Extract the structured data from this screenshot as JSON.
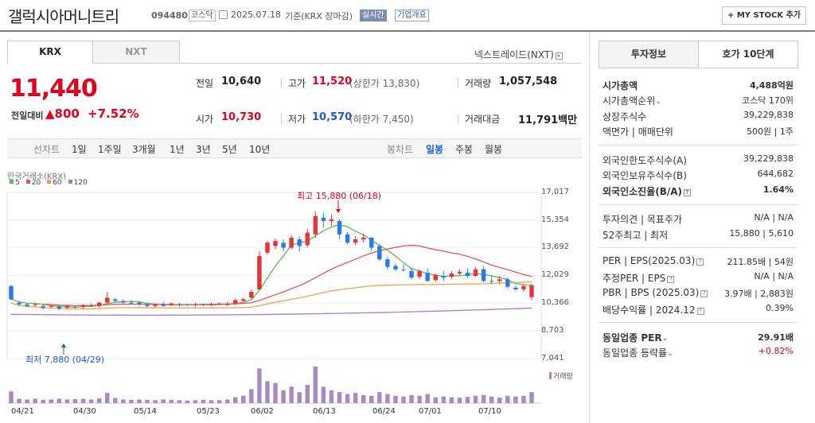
{
  "header": {
    "name": "갤럭시아머니트리",
    "code": "094480",
    "market": "코스닥",
    "date": "2025.07.18",
    "basis": "기준(KRX 장마감)",
    "realtime": "실시간",
    "overview": "기업개요",
    "mystock": "+ MY STOCK 추가"
  },
  "tabs": {
    "krx": "KRX",
    "nxt": "NXT",
    "nxt_link": "넥스트레이드(NXT)"
  },
  "price": {
    "current": "11,440",
    "change_label": "전일대비",
    "change": "▲800",
    "change_pct": "+7.52%"
  },
  "stats": {
    "prev_label": "전일",
    "prev": "10,640",
    "high_label": "고가",
    "high": "11,520",
    "upper_limit": "(상한가 13,830)",
    "volume_label": "거래량",
    "volume": "1,057,548",
    "open_label": "시가",
    "open": "10,730",
    "low_label": "저가",
    "low": "10,570",
    "lower_limit": "(하한가 7,450)",
    "amount_label": "거래대금",
    "amount": "11,791",
    "amount_unit": "백만"
  },
  "period": {
    "line_label": "선차트",
    "p1": "1일",
    "p2": "1주일",
    "p3": "3개월",
    "p4": "1년",
    "p5": "3년",
    "p6": "5년",
    "p7": "10년",
    "candle_label": "봉차트",
    "daily": "일봉",
    "weekly": "주봉",
    "monthly": "월봉"
  },
  "chart": {
    "source": "한국거래소(KRX)",
    "ma": [
      "5",
      "20",
      "60",
      "120"
    ],
    "ma_colors": [
      "#5cb85c",
      "#e8525a",
      "#f0a050",
      "#a87cc8"
    ],
    "high_note": "최고 15,880 (06/18)",
    "low_note": "최저 7,880 (04/29)",
    "yticks": [
      "17,017",
      "15,354",
      "13,692",
      "12,029",
      "10,366",
      "8,703",
      "7,041"
    ],
    "xticks": [
      "04/21",
      "04/30",
      "05/14",
      "05/23",
      "06/02",
      "06/13",
      "06/24",
      "07/01",
      "07/10"
    ],
    "volume_label": "거래량"
  },
  "chart_data": {
    "type": "candlestick",
    "ylim": [
      7041,
      17017
    ],
    "candles": [
      [
        11400,
        10600,
        11450,
        10550
      ],
      [
        10400,
        10300,
        10500,
        10200
      ],
      [
        10300,
        10200,
        10350,
        10150
      ],
      [
        10250,
        10300,
        10400,
        10150
      ],
      [
        10200,
        10100,
        10300,
        10000
      ],
      [
        10150,
        10200,
        10250,
        10100
      ],
      [
        10150,
        10050,
        10250,
        9950
      ],
      [
        10100,
        10200,
        10250,
        10000
      ],
      [
        10150,
        10100,
        10250,
        10050
      ],
      [
        10150,
        10250,
        10300,
        10050
      ],
      [
        10250,
        10250,
        10350,
        10150
      ],
      [
        10200,
        10400,
        10450,
        10100
      ],
      [
        10400,
        10700,
        11050,
        10350
      ],
      [
        10600,
        10500,
        10700,
        10450
      ],
      [
        10500,
        10400,
        10600,
        10350
      ],
      [
        10400,
        10350,
        10550,
        10300
      ],
      [
        10400,
        10300,
        10450,
        10200
      ],
      [
        10300,
        10200,
        10400,
        10100
      ],
      [
        10200,
        10300,
        10350,
        10100
      ],
      [
        10300,
        10200,
        10450,
        10150
      ],
      [
        10250,
        10350,
        10400,
        10200
      ],
      [
        10300,
        10250,
        10400,
        10150
      ],
      [
        10300,
        10250,
        10350,
        10200
      ],
      [
        10250,
        10300,
        10400,
        10150
      ],
      [
        10300,
        10250,
        10350,
        10200
      ],
      [
        10300,
        10300,
        10400,
        10200
      ],
      [
        10300,
        10350,
        10400,
        10250
      ],
      [
        10300,
        10300,
        10450,
        10200
      ],
      [
        10350,
        10550,
        10650,
        10250
      ],
      [
        10500,
        10600,
        10700,
        10450
      ],
      [
        10700,
        11050,
        11200,
        10600
      ],
      [
        11200,
        13200,
        13500,
        11150
      ],
      [
        13400,
        14000,
        14100,
        13300
      ],
      [
        13800,
        14100,
        14250,
        13600
      ],
      [
        14000,
        13700,
        14200,
        13500
      ],
      [
        13700,
        14300,
        14450,
        13600
      ],
      [
        14200,
        13800,
        14400,
        13450
      ],
      [
        13850,
        14600,
        14850,
        13700
      ],
      [
        14500,
        15600,
        15880,
        14300
      ],
      [
        15500,
        15300,
        15800,
        14900
      ],
      [
        15300,
        15400,
        15700,
        15000
      ],
      [
        15300,
        14500,
        15400,
        14200
      ],
      [
        14500,
        14000,
        14650,
        13900
      ],
      [
        14000,
        14200,
        14400,
        13850
      ],
      [
        14200,
        14300,
        14550,
        14000
      ],
      [
        14300,
        13700,
        14350,
        13500
      ],
      [
        13800,
        13000,
        13900,
        12900
      ],
      [
        13000,
        12550,
        13150,
        12400
      ],
      [
        12600,
        12400,
        12750,
        12300
      ],
      [
        12400,
        12350,
        12700,
        12250
      ],
      [
        12300,
        11900,
        12500,
        11800
      ],
      [
        11950,
        12300,
        12400,
        11800
      ],
      [
        12200,
        11700,
        12450,
        11650
      ],
      [
        11750,
        12050,
        12150,
        11650
      ],
      [
        12000,
        11900,
        12300,
        11700
      ],
      [
        11950,
        12150,
        12300,
        11800
      ],
      [
        12150,
        12250,
        12400,
        12050
      ],
      [
        12200,
        12000,
        12450,
        11900
      ],
      [
        12000,
        12400,
        12550,
        11950
      ],
      [
        12400,
        11700,
        12600,
        11600
      ],
      [
        11700,
        11650,
        12000,
        11500
      ],
      [
        11700,
        11800,
        12000,
        11500
      ],
      [
        11800,
        11350,
        11900,
        11250
      ],
      [
        11300,
        11200,
        11400,
        11100
      ],
      [
        11200,
        11400,
        11500,
        11050
      ],
      [
        10730,
        11440,
        11520,
        10570
      ]
    ],
    "volume_scale": [
      0.32,
      0.12,
      0.1,
      0.12,
      0.09,
      0.1,
      0.12,
      0.1,
      0.11,
      0.12,
      0.1,
      0.13,
      0.28,
      0.14,
      0.1,
      0.09,
      0.1,
      0.09,
      0.08,
      0.1,
      0.09,
      0.08,
      0.07,
      0.08,
      0.09,
      0.08,
      0.08,
      0.1,
      0.16,
      0.2,
      0.38,
      0.95,
      0.6,
      0.55,
      0.35,
      0.45,
      0.3,
      0.5,
      1.0,
      0.45,
      0.35,
      0.3,
      0.25,
      0.28,
      0.22,
      0.2,
      0.3,
      0.25,
      0.2,
      0.18,
      0.22,
      0.2,
      0.25,
      0.16,
      0.18,
      0.16,
      0.15,
      0.17,
      0.2,
      0.22,
      0.18,
      0.15,
      0.2,
      0.18,
      0.2,
      0.3
    ]
  },
  "right": {
    "tab_info": "투자정보",
    "tab_hoga": "호가 10단계",
    "r1k": "시가총액",
    "r1v": "4,488억원",
    "r2k": "시가총액순위",
    "r2v": "코스닥 170위",
    "r3k": "상장주식수",
    "r3v": "39,229,838",
    "r4k": "액면가 | 매매단위",
    "r4v": "500원 | 1주",
    "r5k": "외국인한도주식수(A)",
    "r5v": "39,229,838",
    "r6k": "외국인보유주식수(B)",
    "r6v": "644,682",
    "r7k": "외국인소진율(B/A)",
    "r7v": "1.64%",
    "r8k": "투자의견 | 목표주가",
    "r8v": "N/A | N/A",
    "r9k": "52주최고 | 최저",
    "r9v": "15,880 | 5,610",
    "r10k": "PER | EPS(2025.03)",
    "r10v": "211.85배 | 54원",
    "r11k": "추정PER | EPS",
    "r11v": "N/A | N/A",
    "r12k": "PBR | BPS (2025.03)",
    "r12v": "3.97배 | 2,883원",
    "r13k": "배당수익률 | 2024.12",
    "r13v": "0.39%",
    "r14k": "동일업종 PER",
    "r14v": "29.91배",
    "r15k": "동일업종 등락률",
    "r15v": "+0.82%"
  }
}
